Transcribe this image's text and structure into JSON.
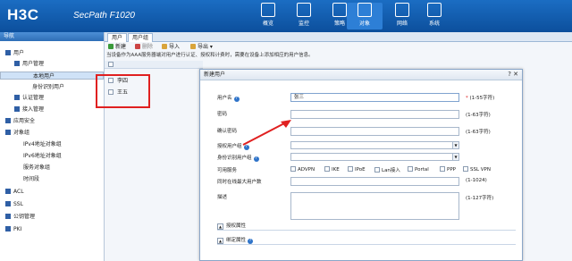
{
  "header": {
    "logo": "H3C",
    "product": "SecPath F1020",
    "nav": [
      {
        "label": "概览",
        "icon": "dashboard-icon"
      },
      {
        "label": "监控",
        "icon": "monitor-icon"
      },
      {
        "label": "策略",
        "icon": "policy-icon"
      },
      {
        "label": "对象",
        "icon": "object-icon"
      },
      {
        "label": "网络",
        "icon": "network-icon"
      },
      {
        "label": "系统",
        "icon": "system-icon"
      }
    ],
    "active_nav": "对象"
  },
  "sidebar": {
    "title": "导航",
    "items": [
      {
        "label": "用户"
      },
      {
        "label": "用户管理"
      },
      {
        "label": "本地用户"
      },
      {
        "label": "身份识别用户"
      },
      {
        "label": "认证管理"
      },
      {
        "label": "接入管理"
      },
      {
        "label": "应用安全"
      },
      {
        "label": "对象组"
      },
      {
        "label": "IPv4地址对象组"
      },
      {
        "label": "IPv6地址对象组"
      },
      {
        "label": "服务对象组"
      },
      {
        "label": "时间段"
      },
      {
        "label": "ACL"
      },
      {
        "label": "SSL"
      },
      {
        "label": "公钥管理"
      },
      {
        "label": "PKI"
      }
    ]
  },
  "main": {
    "tabs": [
      "用户",
      "用户组"
    ],
    "toolbar": {
      "new": "新建",
      "delete": "删除",
      "import": "导入",
      "export": "导出"
    },
    "notice": "当设备作为AAA服务器端对用户进行认证、授权和计费时，需要在设备上添加相应的用户信息。",
    "users": [
      "李四",
      "王五"
    ]
  },
  "dialog": {
    "title": "新建用户",
    "controls": "? ✕",
    "fields": {
      "username_label": "用户名",
      "username_value": "张三",
      "username_hint": "(1-55字符)",
      "password_label": "密码",
      "password_hint": "(1-63字符)",
      "confirm_label": "确认密码",
      "confirm_hint": "(1-63字符)",
      "auth_group_label": "授权用户组",
      "identity_group_label": "身份识别用户组",
      "services_label": "可用服务",
      "services": [
        "ADVPN",
        "IKE",
        "IPoE",
        "Lan接入",
        "Portal",
        "PPP",
        "SSL VPN"
      ],
      "max_online_label": "同时在线最大用户数",
      "max_online_hint": "(1-1024)",
      "desc_label": "描述",
      "desc_hint": "(1-127字符)"
    },
    "sections": [
      "授权属性",
      "绑定属性"
    ]
  }
}
